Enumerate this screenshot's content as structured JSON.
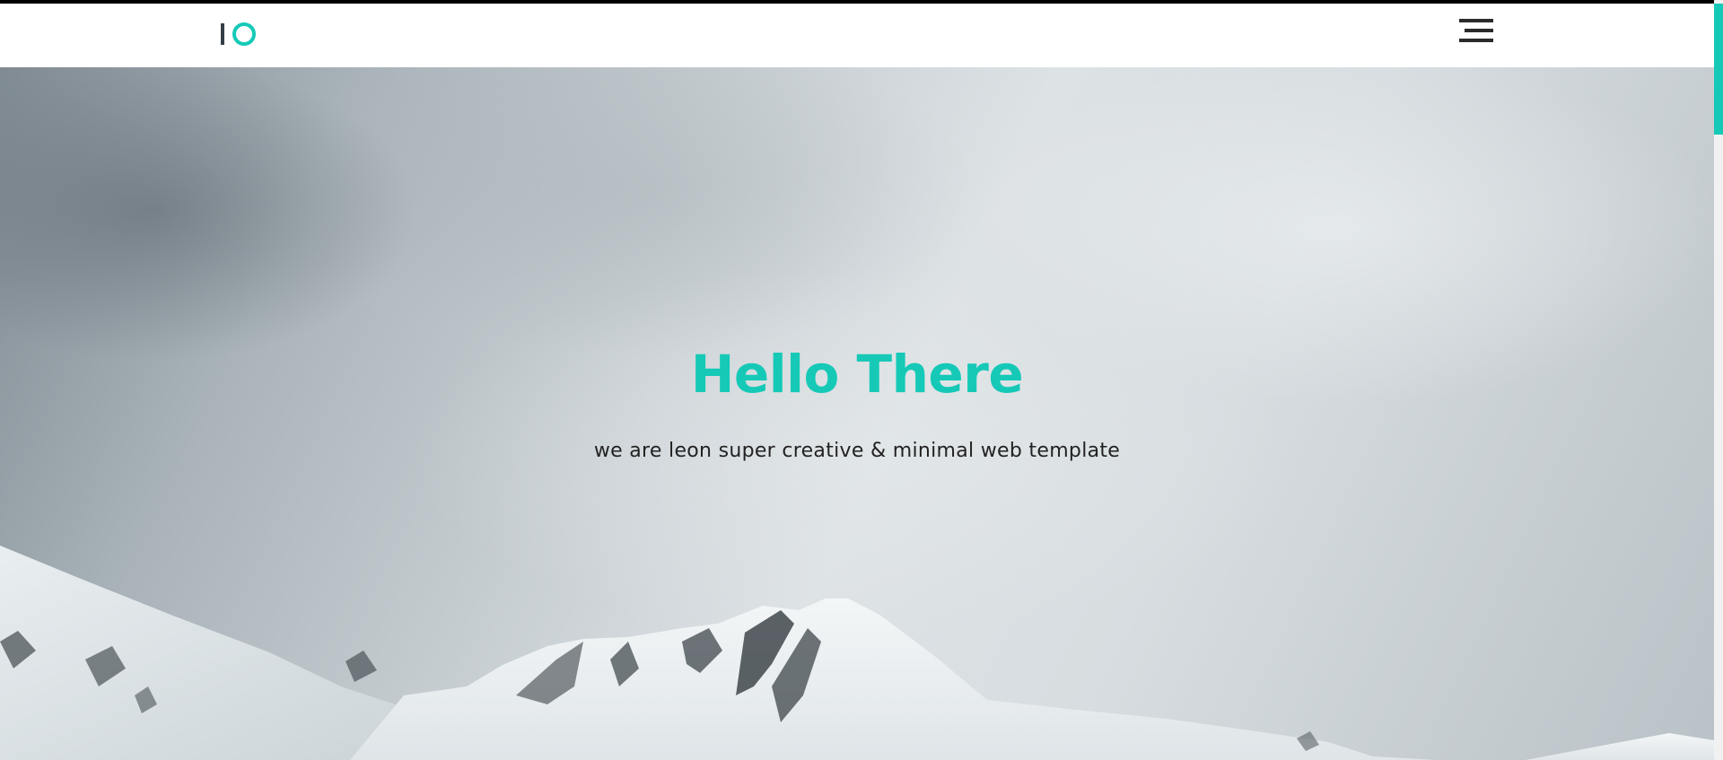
{
  "theme": {
    "accent_color": "#16c9b7",
    "nav_background": "#ffffff",
    "menu_icon_color": "#2b2b2b"
  },
  "header": {
    "logo_icon": "logo-bar-and-ring",
    "menu_icon": "hamburger-menu-icon"
  },
  "hero": {
    "title": "Hello There",
    "subtitle": "we are leon super creative & minimal web template",
    "background": "snowy-mountain-under-cloudy-sky"
  },
  "scrollbar": {
    "accent_color": "#16c9b7"
  }
}
